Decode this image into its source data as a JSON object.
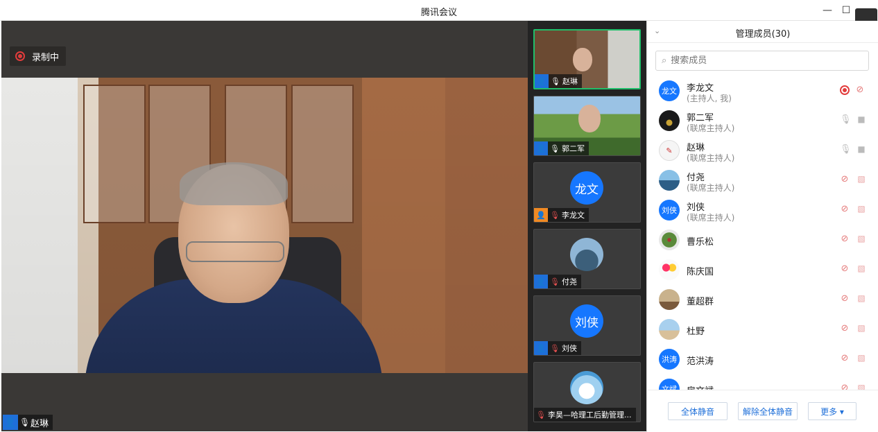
{
  "window": {
    "title": "腾讯会议"
  },
  "main": {
    "recording_label": "录制中",
    "speaker_name": "赵琳"
  },
  "thumbnails": [
    {
      "name": "赵琳",
      "type": "video",
      "mic": "on",
      "active": true
    },
    {
      "name": "郭二军",
      "type": "video",
      "mic": "on",
      "active": false
    },
    {
      "name": "李龙文",
      "type": "avatar",
      "avatar_text": "龙文",
      "mic": "muted",
      "active": false
    },
    {
      "name": "付尧",
      "type": "avatar-photo",
      "mic": "muted",
      "active": false
    },
    {
      "name": "刘侠",
      "type": "avatar",
      "avatar_text": "刘侠",
      "mic": "muted",
      "active": false
    },
    {
      "name": "李昊—哈理工后勤管理...",
      "type": "avatar-photo",
      "mic": "muted",
      "active": false
    }
  ],
  "panel": {
    "title": "管理成员(30)",
    "search_placeholder": "搜索成员",
    "members": [
      {
        "name": "李龙文",
        "role": "(主持人, 我)",
        "avatar_text": "龙文",
        "recording": true
      },
      {
        "name": "郭二军",
        "role": "(联席主持人)",
        "avatar_text": "",
        "mic": "on",
        "cam": "on"
      },
      {
        "name": "赵琳",
        "role": "(联席主持人)",
        "avatar_text": "",
        "mic": "on",
        "cam": "on"
      },
      {
        "name": "付尧",
        "role": "(联席主持人)",
        "avatar_text": "",
        "mic": "muted",
        "cam": "off"
      },
      {
        "name": "刘侠",
        "role": "(联席主持人)",
        "avatar_text": "刘侠",
        "mic": "muted",
        "cam": "off"
      },
      {
        "name": "曹乐松",
        "role": "",
        "avatar_text": "",
        "mic": "muted",
        "cam": "off"
      },
      {
        "name": "陈庆国",
        "role": "",
        "avatar_text": "",
        "mic": "muted",
        "cam": "off"
      },
      {
        "name": "董超群",
        "role": "",
        "avatar_text": "",
        "mic": "muted",
        "cam": "off"
      },
      {
        "name": "杜野",
        "role": "",
        "avatar_text": "",
        "mic": "muted",
        "cam": "off"
      },
      {
        "name": "范洪涛",
        "role": "",
        "avatar_text": "洪涛",
        "mic": "muted",
        "cam": "off"
      },
      {
        "name": "房文斌",
        "role": "",
        "avatar_text": "文斌",
        "mic": "muted",
        "cam": "off"
      }
    ],
    "buttons": {
      "mute_all": "全体静音",
      "unmute_all": "解除全体静音",
      "more": "更多 ▾"
    }
  },
  "colors": {
    "accent": "#1e6fd9",
    "recording": "#e23c3c",
    "active_speaker_border": "#1fbf6a"
  }
}
